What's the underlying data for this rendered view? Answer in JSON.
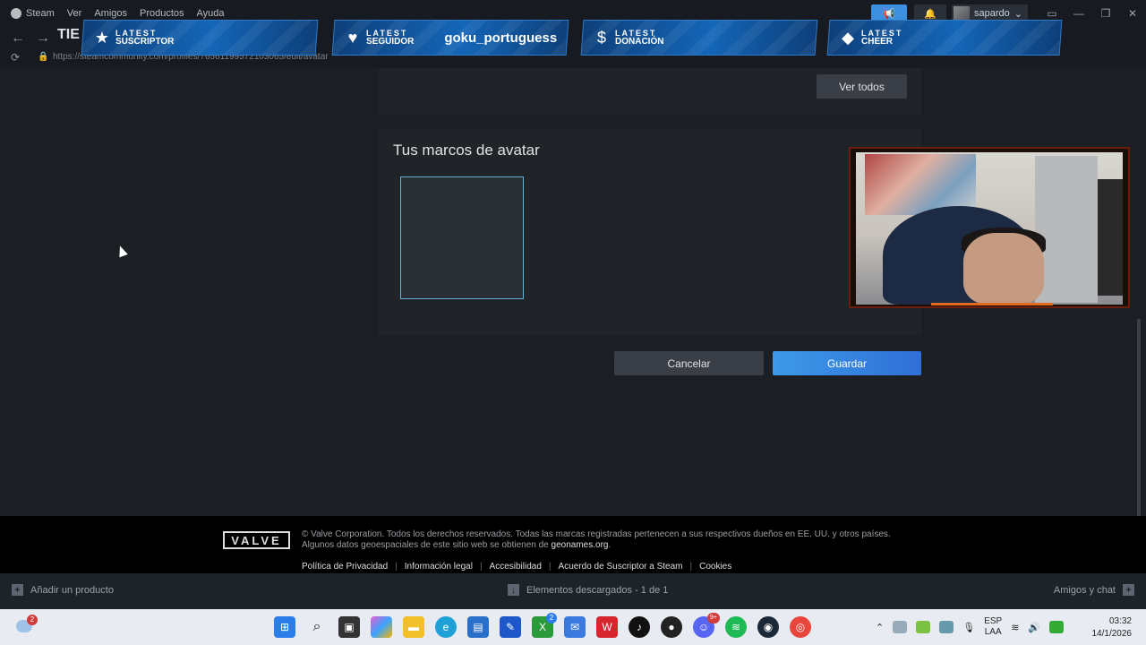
{
  "menubar": {
    "app": "Steam",
    "items": [
      "Ver",
      "Amigos",
      "Productos",
      "Ayuda"
    ],
    "username": "sapardo"
  },
  "nav": {
    "title": "TIE",
    "url": "https://steamcommunity.com/profiles/76561199572103065/edit/avatar"
  },
  "overlay": {
    "alerts": [
      {
        "icon": "star-icon",
        "line1": "LATEST",
        "line2": "SUSCRIPTOR",
        "name": ""
      },
      {
        "icon": "heart-icon",
        "line1": "LATEST",
        "line2": "SEGUIDOR",
        "name": "goku_portuguess"
      },
      {
        "icon": "dollar-icon",
        "line1": "LATEST",
        "line2": "DONACIÓN",
        "name": ""
      },
      {
        "icon": "diamond-icon",
        "line1": "LATEST",
        "line2": "CHEER",
        "name": ""
      }
    ]
  },
  "page": {
    "view_all": "Ver todos",
    "frames_title": "Tus marcos de avatar",
    "cancel": "Cancelar",
    "save": "Guardar"
  },
  "footer": {
    "logo": "VALVE",
    "copyright": "© Valve Corporation. Todos los derechos reservados. Todas las marcas registradas pertenecen a sus respectivos dueños en EE. UU. y otros países.",
    "geo_prefix": "Algunos datos geoespaciales de este sitio web se obtienen de",
    "geo_link": "geonames.org",
    "geo_suffix": ".",
    "links": [
      "Política de Privacidad",
      "Información legal",
      "Accesibilidad",
      "Acuerdo de Suscriptor a Steam",
      "Cookies"
    ]
  },
  "bottombar": {
    "add_product": "Añadir un producto",
    "downloads": "Elementos descargados - 1 de 1",
    "friends": "Amigos y chat"
  },
  "taskbar": {
    "weather_badge": "2",
    "xbox_badge": "2",
    "discord_badge": "9+",
    "lang_line1": "ESP",
    "lang_line2": "LAA",
    "time": "03:32",
    "date": "14/1/2026"
  },
  "colors": {
    "accent_blue": "#3d9ae8",
    "frame_border": "#5fb3d4",
    "background": "#1b1e23"
  }
}
